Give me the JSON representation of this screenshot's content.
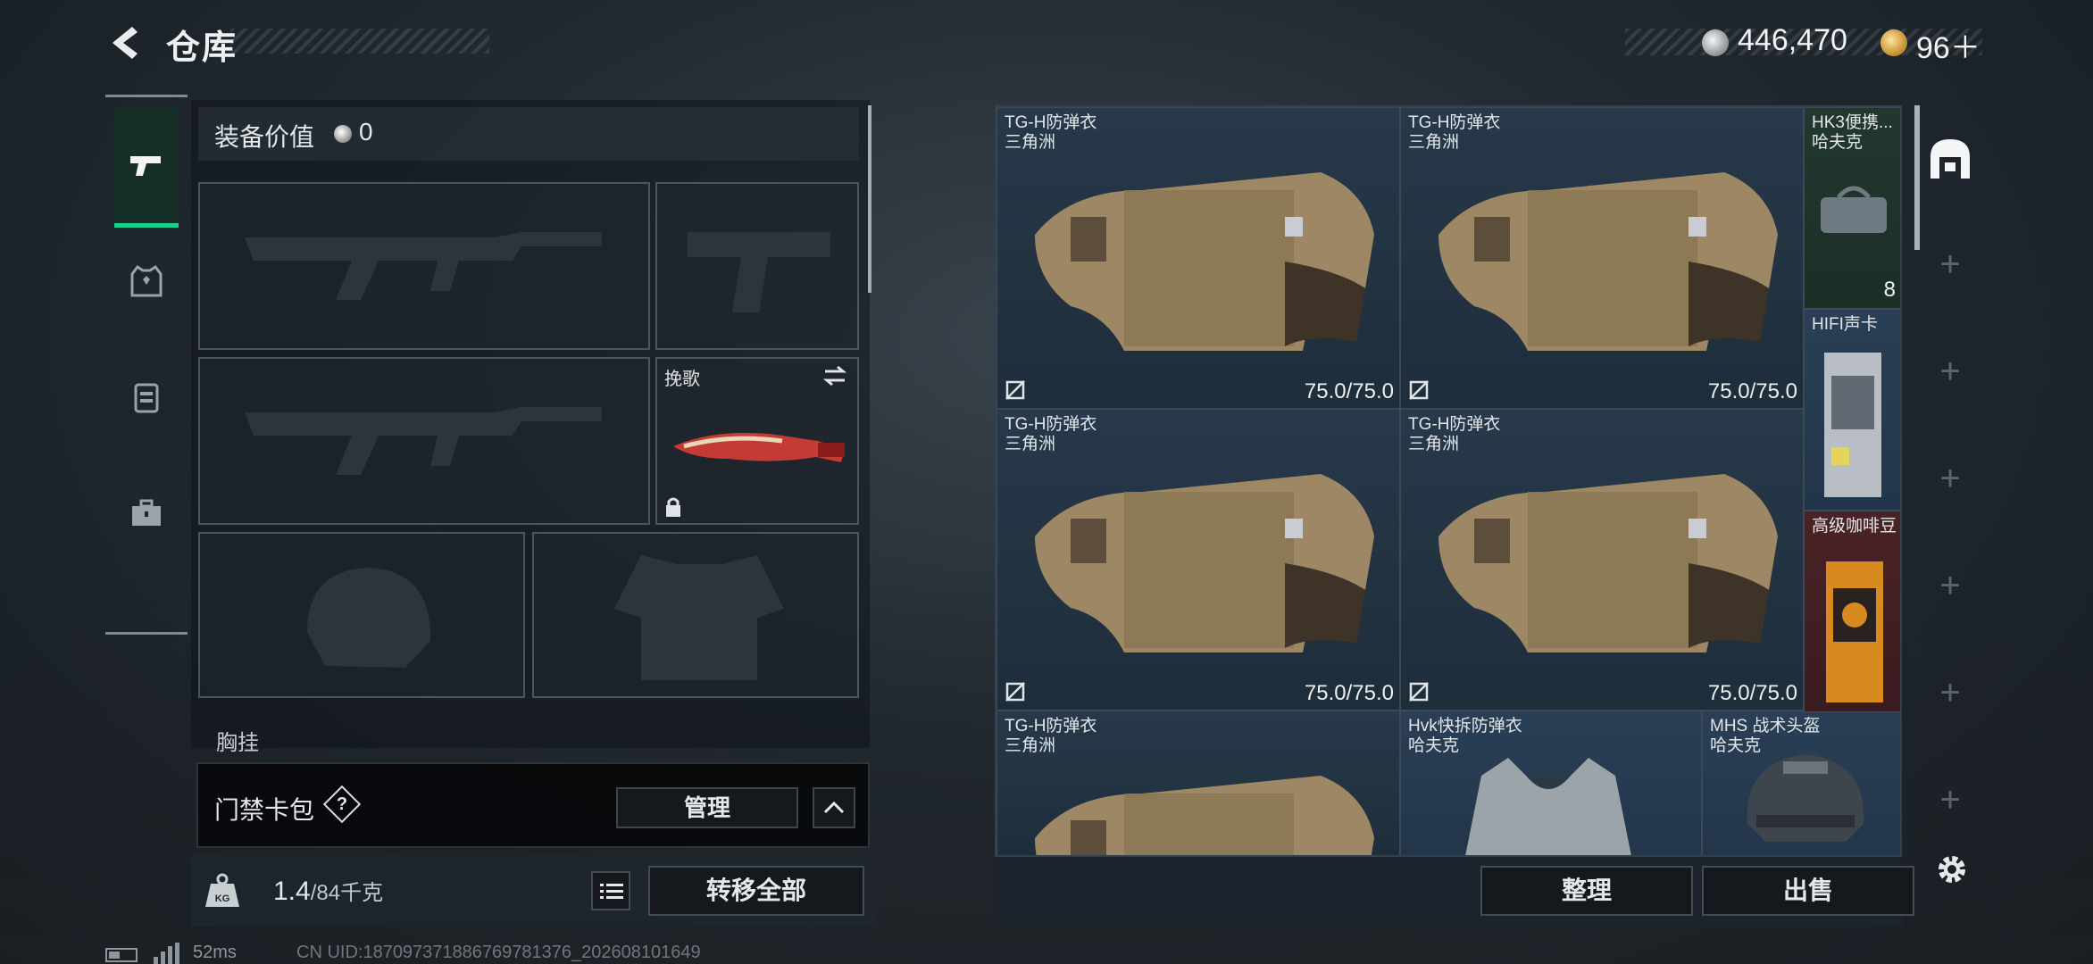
{
  "header": {
    "title": "仓库",
    "currency_silver": "446,470",
    "currency_gold": "96＋"
  },
  "equipment": {
    "value_label": "装备价值",
    "value": "0",
    "melee_slot_name": "挽歌",
    "chest_rig_label": "胸挂"
  },
  "card_bag": {
    "label": "门禁卡包",
    "help": "?",
    "manage_label": "管理"
  },
  "weight_bar": {
    "current": "1.4",
    "max": "/84千克",
    "transfer_all_label": "转移全部"
  },
  "status_bar": {
    "latency": "52ms",
    "uid": "CN UID:187097371886769781376_202608101649"
  },
  "storage": {
    "items": [
      {
        "name": "TG-H防弹衣",
        "sub": "三角洲",
        "durability": "75.0/75.0"
      },
      {
        "name": "TG-H防弹衣",
        "sub": "三角洲",
        "durability": "75.0/75.0"
      },
      {
        "name": "TG-H防弹衣",
        "sub": "三角洲",
        "durability": "75.0/75.0"
      },
      {
        "name": "TG-H防弹衣",
        "sub": "三角洲",
        "durability": "75.0/75.0"
      },
      {
        "name": "TG-H防弹衣",
        "sub": "三角洲",
        "durability": ""
      },
      {
        "name": "Hvk快拆防弹衣",
        "sub": "哈夫克",
        "durability": ""
      },
      {
        "name": "MHS 战术头盔",
        "sub": "哈夫克",
        "durability": ""
      }
    ],
    "small_items": [
      {
        "name": "HK3便携...",
        "sub": "哈夫克",
        "count": "8"
      },
      {
        "name": "HIFI声卡",
        "sub": "",
        "count": ""
      },
      {
        "name": "高级咖啡豆",
        "sub": "",
        "count": ""
      }
    ],
    "sort_label": "整理",
    "sell_label": "出售"
  },
  "right_tabs": [
    "+",
    "+",
    "+",
    "+",
    "+",
    "+"
  ],
  "colors": {
    "accent_green": "#19d18a",
    "rare_red": "#4a2326"
  }
}
